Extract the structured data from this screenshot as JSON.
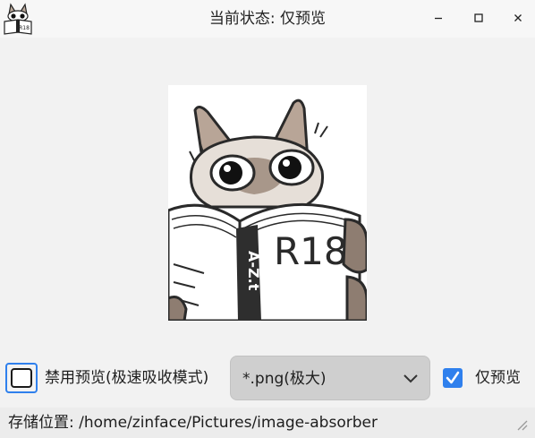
{
  "window": {
    "title": "当前状态: 仅预览",
    "buttons": [
      "minimize-icon",
      "maximize-icon",
      "close-icon"
    ]
  },
  "preview": {
    "book_text": "R18",
    "spine_text": "A-Z.t"
  },
  "controls": {
    "disable_preview_label": "禁用预览(极速吸收模式)",
    "disable_preview_checked": false,
    "format_value": "*.png(极大)",
    "preview_only_label": "仅预览",
    "preview_only_checked": true
  },
  "status": {
    "text": "存储位置: /home/zinface/Pictures/image-absorber"
  },
  "colors": {
    "accent": "#2f80ed",
    "background": "#f2f2f2",
    "combo": "#cfcfcf"
  }
}
